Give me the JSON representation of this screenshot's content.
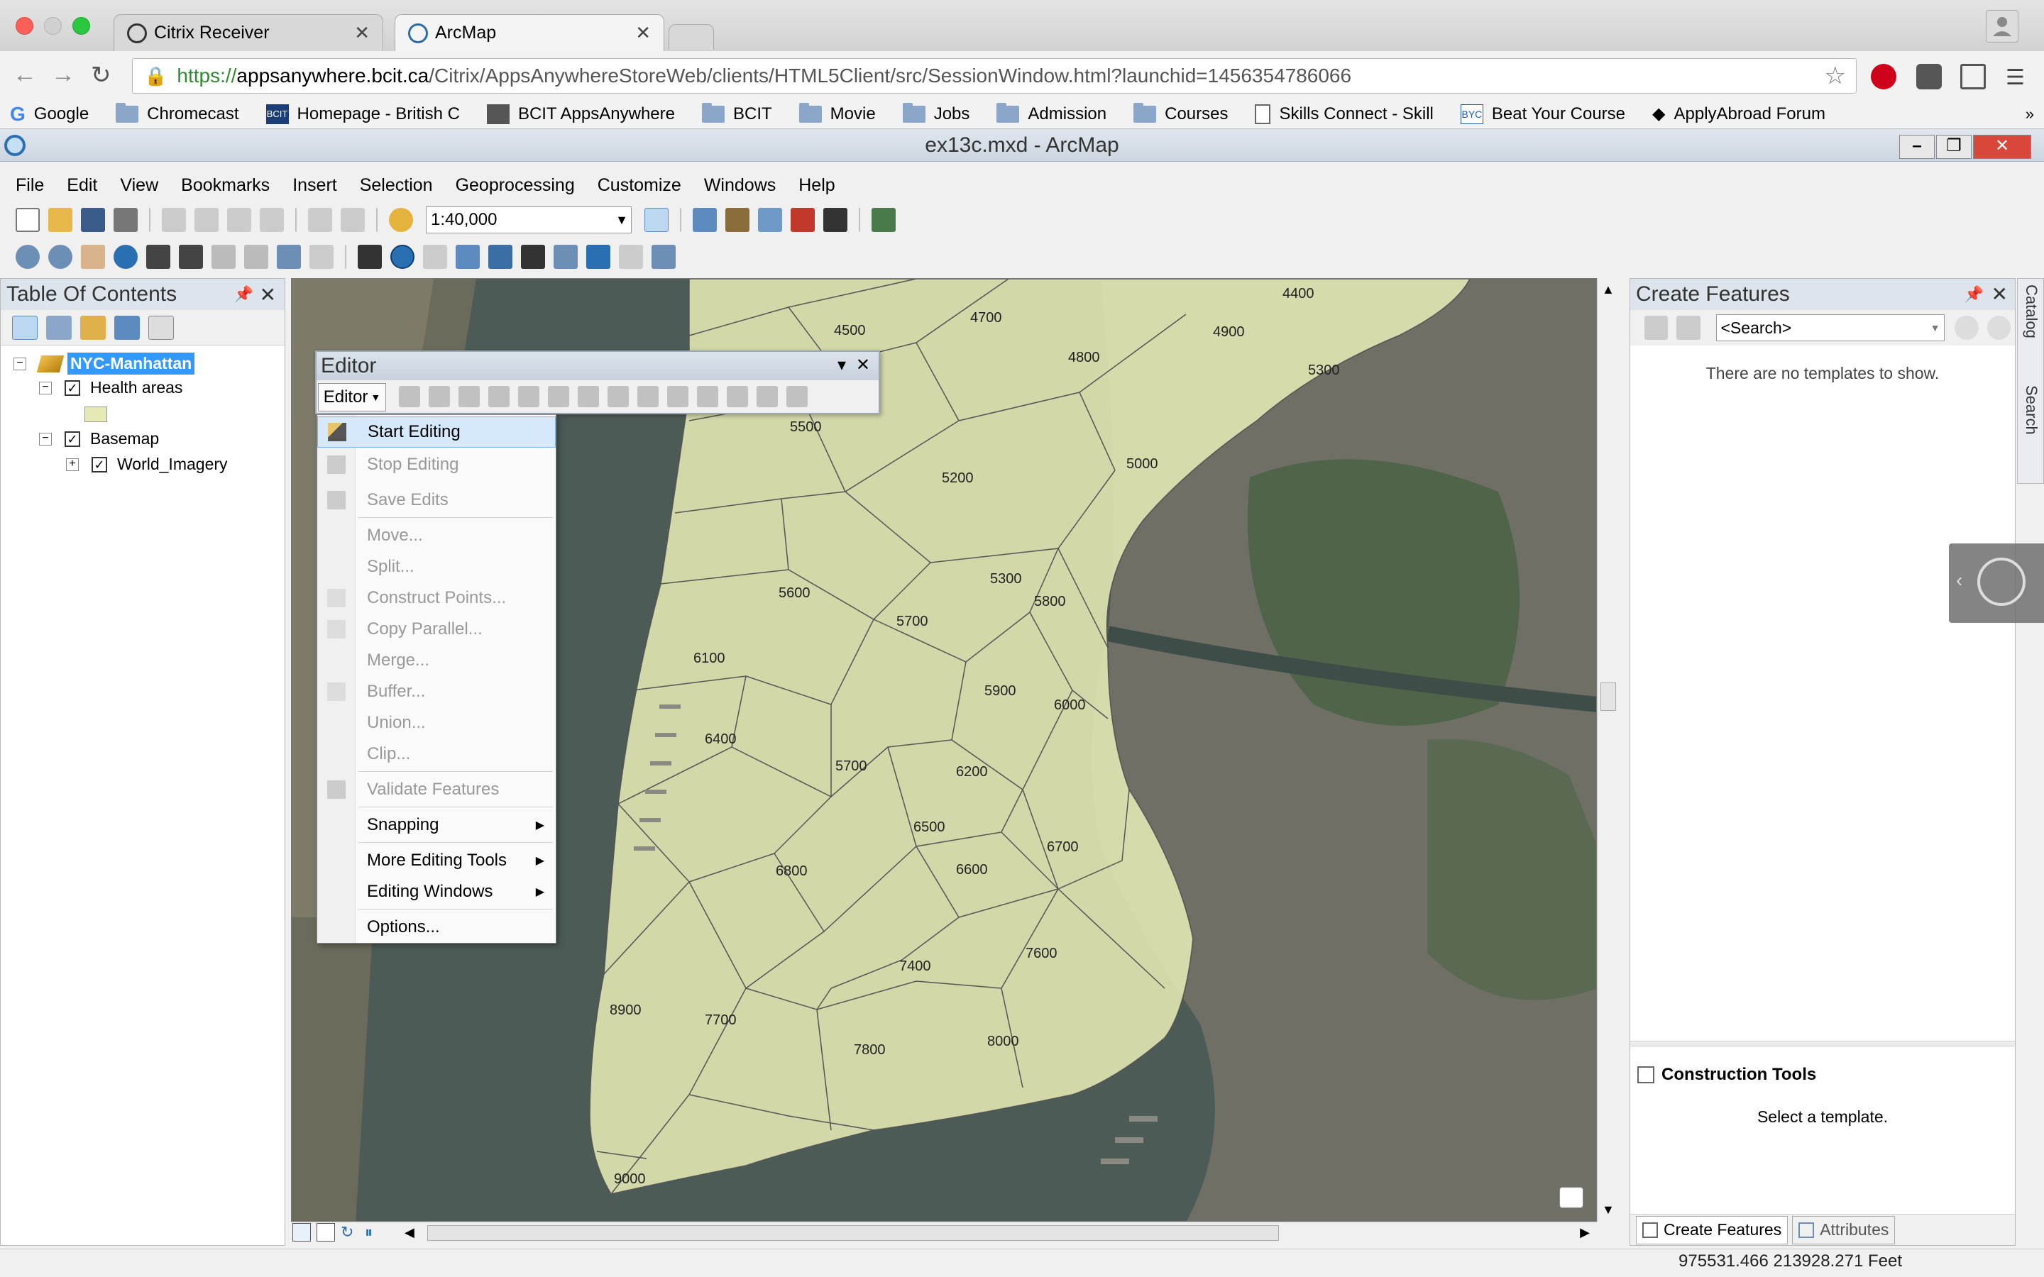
{
  "browser": {
    "tabs": [
      {
        "title": "Citrix Receiver",
        "active": false
      },
      {
        "title": "ArcMap",
        "active": true
      }
    ],
    "url": {
      "scheme": "https://",
      "host": "appsanywhere.bcit.ca",
      "path": "/Citrix/AppsAnywhereStoreWeb/clients/HTML5Client/src/SessionWindow.html?launchid=1456354786066"
    },
    "bookmarks": [
      {
        "label": "Google",
        "icon": "google-icon"
      },
      {
        "label": "Chromecast",
        "icon": "folder-icon"
      },
      {
        "label": "Homepage - British C",
        "icon": "bcit-icon"
      },
      {
        "label": "BCIT AppsAnywhere",
        "icon": "app-icon"
      },
      {
        "label": "BCIT",
        "icon": "folder-icon"
      },
      {
        "label": "Movie",
        "icon": "folder-icon"
      },
      {
        "label": "Jobs",
        "icon": "folder-icon"
      },
      {
        "label": "Admission",
        "icon": "folder-icon"
      },
      {
        "label": "Courses",
        "icon": "folder-icon"
      },
      {
        "label": "Skills Connect - Skill",
        "icon": "page-icon"
      },
      {
        "label": "Beat Your Course",
        "icon": "byc-icon"
      },
      {
        "label": "ApplyAbroad Forum",
        "icon": "cap-icon"
      }
    ]
  },
  "arcmap": {
    "window_title": "ex13c.mxd - ArcMap",
    "menus": [
      "File",
      "Edit",
      "View",
      "Bookmarks",
      "Insert",
      "Selection",
      "Geoprocessing",
      "Customize",
      "Windows",
      "Help"
    ],
    "scale": "1:40,000",
    "colors": {
      "zone_fill": "#e6e9b5",
      "highlight": "#3399ff",
      "panel_header": "#dde4ec"
    }
  },
  "toc": {
    "title": "Table Of Contents",
    "root": "NYC-Manhattan",
    "layers": [
      {
        "label": "Health areas",
        "checked": true
      },
      {
        "label": "Basemap",
        "checked": true
      },
      {
        "label": "World_Imagery",
        "checked": true
      }
    ]
  },
  "map": {
    "zone_labels": [
      "4400",
      "4500",
      "4700",
      "4800",
      "4900",
      "5300",
      "5500",
      "5200",
      "5000",
      "5600",
      "5300",
      "5800",
      "5700",
      "6100",
      "5900",
      "6000",
      "6400",
      "5700",
      "6200",
      "6500",
      "6700",
      "6600",
      "6800",
      "7400",
      "7600",
      "8900",
      "7700",
      "7800",
      "8000",
      "9000"
    ],
    "coordinates": "975531.466  213928.271 Feet"
  },
  "editor": {
    "toolbar_title": "Editor",
    "dropdown_label": "Editor",
    "menu": [
      {
        "label": "Start Editing",
        "enabled": true,
        "highlighted": true
      },
      {
        "label": "Stop Editing",
        "enabled": false
      },
      {
        "label": "Save Edits",
        "enabled": false
      },
      {
        "label": "Move...",
        "enabled": false
      },
      {
        "label": "Split...",
        "enabled": false
      },
      {
        "label": "Construct Points...",
        "enabled": false
      },
      {
        "label": "Copy Parallel...",
        "enabled": false
      },
      {
        "label": "Merge...",
        "enabled": false
      },
      {
        "label": "Buffer...",
        "enabled": false
      },
      {
        "label": "Union...",
        "enabled": false
      },
      {
        "label": "Clip...",
        "enabled": false
      },
      {
        "label": "Validate Features",
        "enabled": false
      },
      {
        "label": "Snapping",
        "enabled": true,
        "submenu": true
      },
      {
        "label": "More Editing Tools",
        "enabled": true,
        "submenu": true
      },
      {
        "label": "Editing Windows",
        "enabled": true,
        "submenu": true
      },
      {
        "label": "Options...",
        "enabled": true
      }
    ]
  },
  "create_features": {
    "title": "Create Features",
    "search_placeholder": "<Search>",
    "empty_text": "There are no templates to show.",
    "construction_title": "Construction Tools",
    "construction_text": "Select a template.",
    "tabs": [
      "Create Features",
      "Attributes"
    ],
    "side_tabs": [
      "Catalog",
      "Search"
    ]
  }
}
